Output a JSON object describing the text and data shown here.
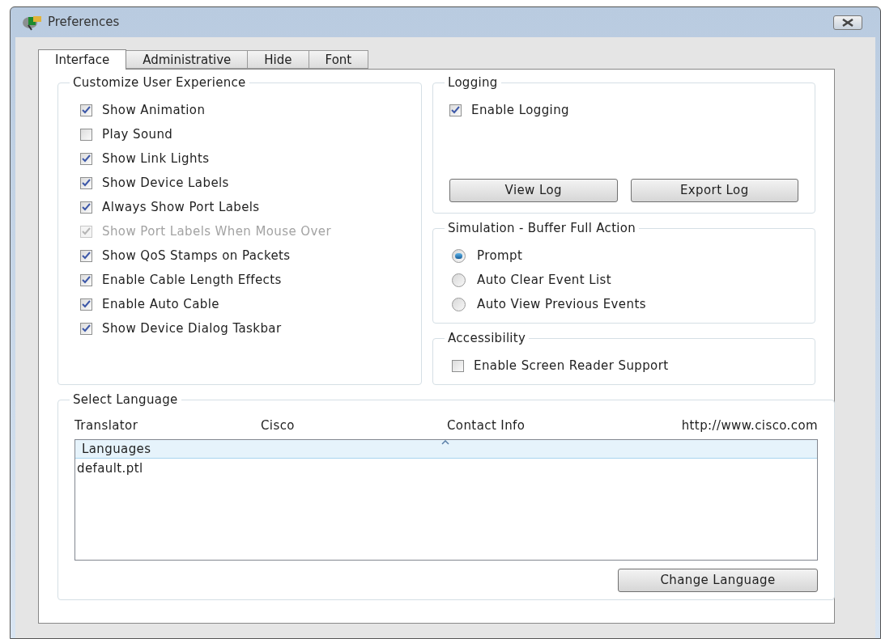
{
  "window": {
    "title": "Preferences"
  },
  "tabs": [
    {
      "label": "Interface",
      "selected": true
    },
    {
      "label": "Administrative",
      "selected": false
    },
    {
      "label": "Hide",
      "selected": false
    },
    {
      "label": "Font",
      "selected": false
    }
  ],
  "customize": {
    "title": "Customize User Experience",
    "options": [
      {
        "label": "Show Animation",
        "checked": true,
        "disabled": false
      },
      {
        "label": "Play Sound",
        "checked": false,
        "disabled": false
      },
      {
        "label": "Show Link Lights",
        "checked": true,
        "disabled": false
      },
      {
        "label": "Show Device Labels",
        "checked": true,
        "disabled": false
      },
      {
        "label": "Always Show Port Labels",
        "checked": true,
        "disabled": false
      },
      {
        "label": "Show Port Labels When Mouse Over",
        "checked": true,
        "disabled": true
      },
      {
        "label": "Show QoS Stamps on Packets",
        "checked": true,
        "disabled": false
      },
      {
        "label": "Enable Cable Length Effects",
        "checked": true,
        "disabled": false
      },
      {
        "label": "Enable Auto Cable",
        "checked": true,
        "disabled": false
      },
      {
        "label": "Show Device Dialog Taskbar",
        "checked": true,
        "disabled": false
      }
    ]
  },
  "logging": {
    "title": "Logging",
    "options": [
      {
        "label": "Enable Logging",
        "checked": true,
        "disabled": false
      }
    ],
    "buttons": [
      "View Log",
      "Export Log"
    ]
  },
  "simulation": {
    "title": "Simulation - Buffer Full Action",
    "options": [
      {
        "label": "Prompt",
        "selected": true
      },
      {
        "label": "Auto Clear Event List",
        "selected": false
      },
      {
        "label": "Auto View Previous Events",
        "selected": false
      }
    ]
  },
  "accessibility": {
    "title": "Accessibility",
    "options": [
      {
        "label": "Enable Screen Reader Support",
        "checked": false,
        "disabled": false
      }
    ]
  },
  "language": {
    "title": "Select Language",
    "info": [
      "Translator",
      "Cisco",
      "Contact Info",
      "http://www.cisco.com"
    ],
    "list": {
      "header": "Languages",
      "rows": [
        "default.ptl"
      ]
    },
    "button": "Change Language"
  }
}
